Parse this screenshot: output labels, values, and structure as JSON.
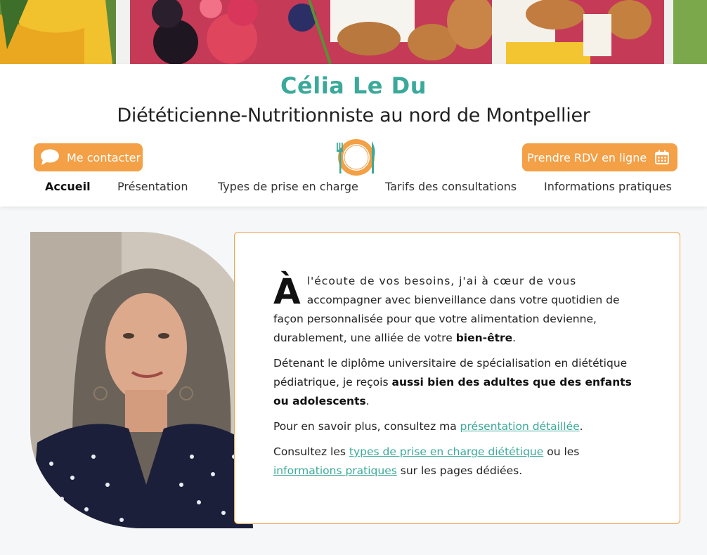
{
  "header": {
    "title": "Célia Le Du",
    "subtitle": "Diététicienne-Nutritionniste au nord de Montpellier",
    "contact_button": "Me contacter",
    "rdv_button": "Prendre RDV en ligne"
  },
  "nav": {
    "items": [
      {
        "label": "Accueil",
        "active": true
      },
      {
        "label": "Présentation"
      },
      {
        "label": "Types de prise en charge"
      },
      {
        "label": "Tarifs des consultations"
      },
      {
        "label": "Informations pratiques"
      }
    ]
  },
  "content": {
    "dropcap": "À",
    "p1_first": "l'écoute de vos besoins, j'ai à cœur de vous",
    "p1_rest": "accompagner avec bienveillance dans votre quotidien de façon personnalisée pour que votre alimentation devienne, durablement, une alliée de votre",
    "p1_bold": "bien-être",
    "p1_end": ".",
    "p2_text": "Détenant le diplôme universitaire de spécialisation en diététique pédiatrique, je reçois",
    "p2_bold": "aussi bien des adultes que des enfants ou adolescents",
    "p2_end": ".",
    "p3_text": "Pour en savoir plus, consultez ma",
    "p3_link": "présentation détaillée",
    "p3_end": ".",
    "p4_text": "Consultez les",
    "p4_link1": "types de prise en charge diététique",
    "p4_mid": "ou les",
    "p4_link2": "informations pratiques",
    "p4_end": "sur les pages dédiées."
  },
  "colors": {
    "accent_teal": "#3aa99a",
    "accent_orange": "#f3a046",
    "background": "#f6f7f9"
  },
  "icons": {
    "contact": "speech-bubble-icon",
    "rdv": "calendar-icon",
    "logo": "plate-fork-knife-logo"
  }
}
